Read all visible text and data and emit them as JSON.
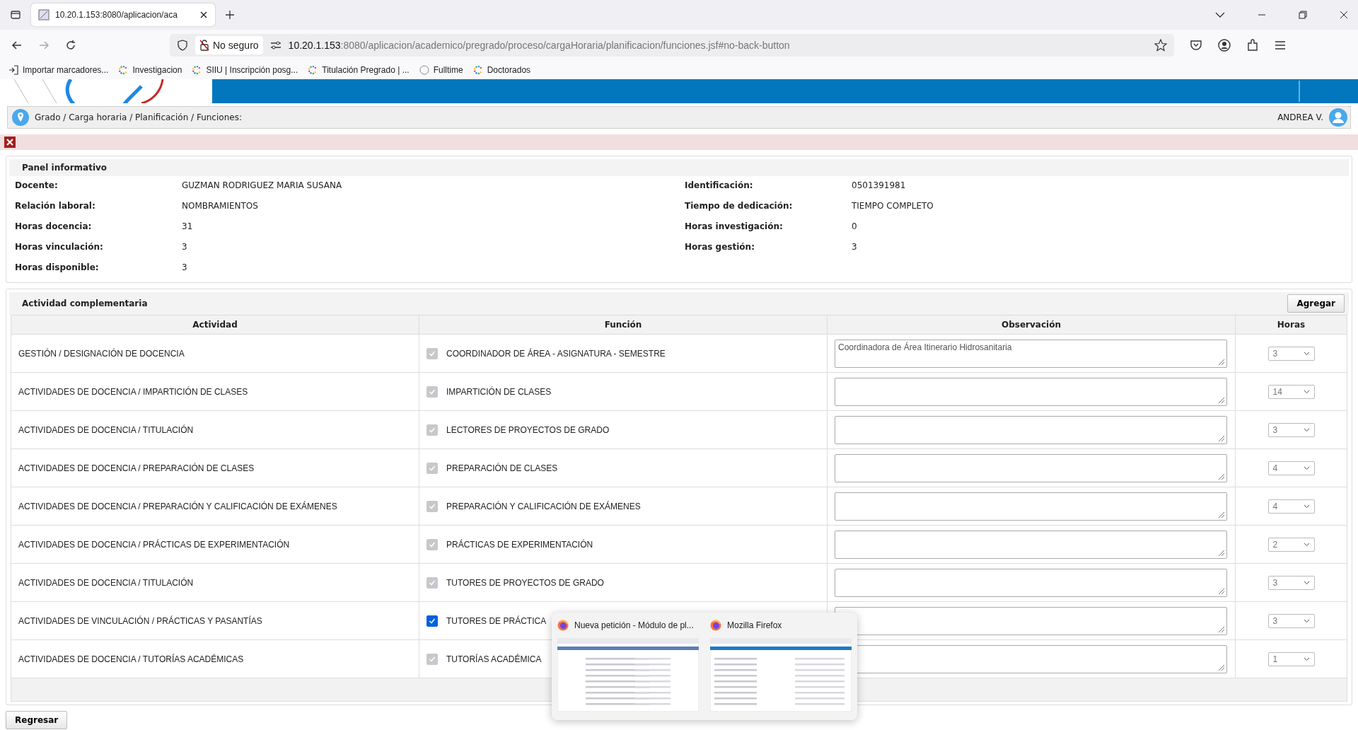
{
  "browser": {
    "tab_title": "10.20.1.153:8080/aplicacion/aca",
    "security": "No seguro",
    "url_host": "10.20.1.153",
    "url_rest": ":8080/aplicacion/academico/pregrado/proceso/cargaHoraria/planificacion/funciones.jsf#no-back-button",
    "bookmarks": [
      {
        "label": "Importar marcadores...",
        "kind": "import"
      },
      {
        "label": "Investigacion",
        "kind": "dots"
      },
      {
        "label": "SIIU | Inscripción posg...",
        "kind": "dots"
      },
      {
        "label": "Titulación Pregrado | ...",
        "kind": "dots"
      },
      {
        "label": "Fulltime",
        "kind": "globe"
      },
      {
        "label": "Doctorados",
        "kind": "dots"
      }
    ]
  },
  "breadcrumb": "Grado / Carga horaria / Planificación / Funciones:",
  "user": "ANDREA V.",
  "info_panel": {
    "title": "Panel informativo",
    "fields": [
      {
        "label": "Docente:",
        "value": "GUZMAN RODRIGUEZ MARIA SUSANA"
      },
      {
        "label": "Identificación:",
        "value": "0501391981"
      },
      {
        "label": "Relación laboral:",
        "value": "NOMBRAMIENTOS"
      },
      {
        "label": "Tiempo de dedicación:",
        "value": "TIEMPO COMPLETO"
      },
      {
        "label": "Horas docencia:",
        "value": "31"
      },
      {
        "label": "Horas investigación:",
        "value": "0"
      },
      {
        "label": "Horas vinculación:",
        "value": "3"
      },
      {
        "label": "Horas gestión:",
        "value": "3"
      },
      {
        "label": "Horas disponible:",
        "value": "3"
      }
    ]
  },
  "activities": {
    "title": "Actividad complementaria",
    "add_button": "Agregar",
    "columns": [
      "Actividad",
      "Función",
      "Observación",
      "Horas"
    ],
    "rows": [
      {
        "activity": "GESTIÓN / DESIGNACIÓN DE DOCENCIA",
        "checked": true,
        "disabled": true,
        "function": "COORDINADOR DE ÁREA - ASIGNATURA - SEMESTRE",
        "observation": "Coordinadora de Área Itinerario Hidrosanitaria",
        "hours": "3"
      },
      {
        "activity": "ACTIVIDADES DE DOCENCIA / IMPARTICIÓN DE CLASES",
        "checked": true,
        "disabled": true,
        "function": "IMPARTICIÓN DE CLASES",
        "hours": "14"
      },
      {
        "activity": "ACTIVIDADES DE DOCENCIA / TITULACIÓN",
        "checked": true,
        "disabled": true,
        "function": "LECTORES DE PROYECTOS DE GRADO",
        "hours": "3"
      },
      {
        "activity": "ACTIVIDADES DE DOCENCIA / PREPARACIÓN DE CLASES",
        "checked": true,
        "disabled": true,
        "function": "PREPARACIÓN DE CLASES",
        "hours": "4"
      },
      {
        "activity": "ACTIVIDADES DE DOCENCIA / PREPARACIÓN Y CALIFICACIÓN DE EXÁMENES",
        "checked": true,
        "disabled": true,
        "function": "PREPARACIÓN Y CALIFICACIÓN DE EXÁMENES",
        "hours": "4"
      },
      {
        "activity": "ACTIVIDADES DE DOCENCIA / PRÁCTICAS DE EXPERIMENTACIÓN",
        "checked": true,
        "disabled": true,
        "function": "PRÁCTICAS DE EXPERIMENTACIÓN",
        "hours": "2"
      },
      {
        "activity": "ACTIVIDADES DE DOCENCIA / TITULACIÓN",
        "checked": true,
        "disabled": true,
        "function": "TUTORES DE PROYECTOS DE GRADO",
        "hours": "3"
      },
      {
        "activity": "ACTIVIDADES DE VINCULACIÓN / PRÁCTICAS Y PASANTÍAS",
        "checked": true,
        "disabled": false,
        "function": "TUTORES DE PRÁCTICA",
        "hours": "3"
      },
      {
        "activity": "ACTIVIDADES DE DOCENCIA / TUTORÍAS ACADÉMICAS",
        "checked": true,
        "disabled": true,
        "function": "TUTORÍAS ACADÉMICA",
        "hours": "1"
      }
    ]
  },
  "back_button": "Regresar",
  "taskbar_preview": [
    {
      "title": "Nueva petición - Módulo de pl..."
    },
    {
      "title": "Mozilla Firefox"
    }
  ]
}
